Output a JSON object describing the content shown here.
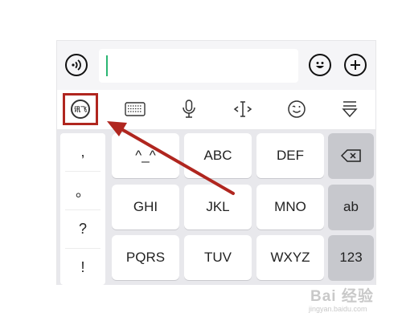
{
  "input_bar": {
    "voice_icon": "voice-waves-icon",
    "text_value": "",
    "emoji_icon": "emoji-face-icon",
    "plus_icon": "plus-icon"
  },
  "toolbar": {
    "logo_text": "讯飞",
    "icons": [
      "ifly-logo-icon",
      "keyboard-icon",
      "microphone-icon",
      "text-cursor-icon",
      "smiley-icon",
      "hide-keyboard-icon"
    ]
  },
  "keyboard": {
    "punctuation": [
      ",",
      "。",
      "?",
      "!"
    ],
    "rows": [
      [
        "^_^",
        "ABC",
        "DEF"
      ],
      [
        "GHI",
        "JKL",
        "MNO"
      ],
      [
        "PQRS",
        "TUV",
        "WXYZ"
      ]
    ],
    "side_keys": [
      "delete-icon",
      "ab",
      "123"
    ]
  },
  "annotation": {
    "highlight_color": "#b0261f",
    "arrow_color": "#b0261f"
  },
  "watermark": {
    "brand": "Bai 经验",
    "url": "jingyan.baidu.com"
  }
}
